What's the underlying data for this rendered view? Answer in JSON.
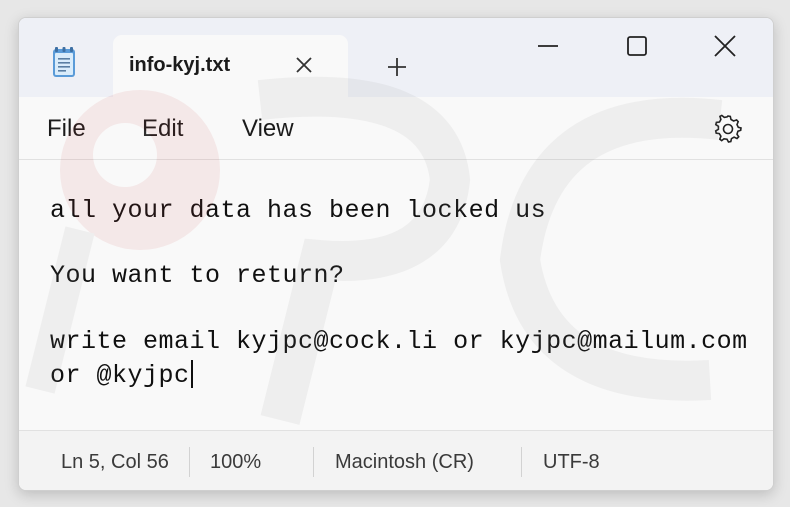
{
  "tab": {
    "title": "info-kyj.txt"
  },
  "menu": {
    "file": "File",
    "edit": "Edit",
    "view": "View"
  },
  "icons": {
    "app": "notepad-icon",
    "tab_close": "close-icon",
    "new_tab": "plus-icon",
    "minimize": "minimize-icon",
    "maximize": "maximize-icon",
    "close": "close-icon",
    "settings": "gear-icon"
  },
  "editor": {
    "lines": [
      "all your data has been locked us",
      "You want to return?",
      "write email kyjpc@cock.li or kyjpc@mailum.com",
      "or @kyjpc"
    ]
  },
  "status": {
    "position": "Ln 5, Col 56",
    "zoom": "100%",
    "line_ending": "Macintosh (CR)",
    "encoding": "UTF-8"
  },
  "colors": {
    "titlebar": "#eef0f6",
    "editor_bg": "#f9f9f9",
    "text": "#101010"
  }
}
